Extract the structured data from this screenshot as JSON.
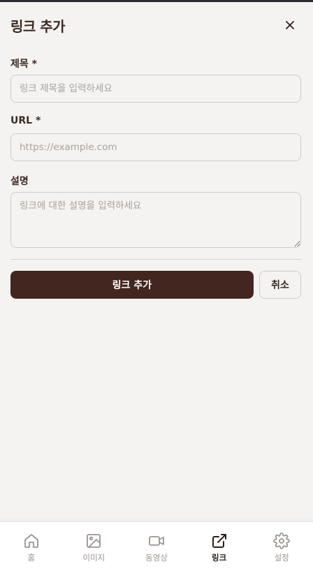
{
  "header": {
    "title": "링크 추가"
  },
  "form": {
    "title_label": "제목 *",
    "title_placeholder": "링크 제목을 입력하세요",
    "url_label": "URL *",
    "url_placeholder": "https://example.com",
    "desc_label": "설명",
    "desc_placeholder": "링크에 대한 설명을 입력하세요"
  },
  "actions": {
    "submit_label": "링크 추가",
    "cancel_label": "취소"
  },
  "nav": {
    "items": [
      {
        "label": "홈",
        "icon": "home-icon",
        "active": false
      },
      {
        "label": "이미지",
        "icon": "image-icon",
        "active": false
      },
      {
        "label": "동영상",
        "icon": "video-icon",
        "active": false
      },
      {
        "label": "링크",
        "icon": "external-link-icon",
        "active": true
      },
      {
        "label": "설정",
        "icon": "gear-icon",
        "active": false
      }
    ]
  },
  "colors": {
    "primary": "#43261f",
    "background": "#f5f3f1",
    "text": "#3a2a24",
    "muted": "#9b9490"
  }
}
